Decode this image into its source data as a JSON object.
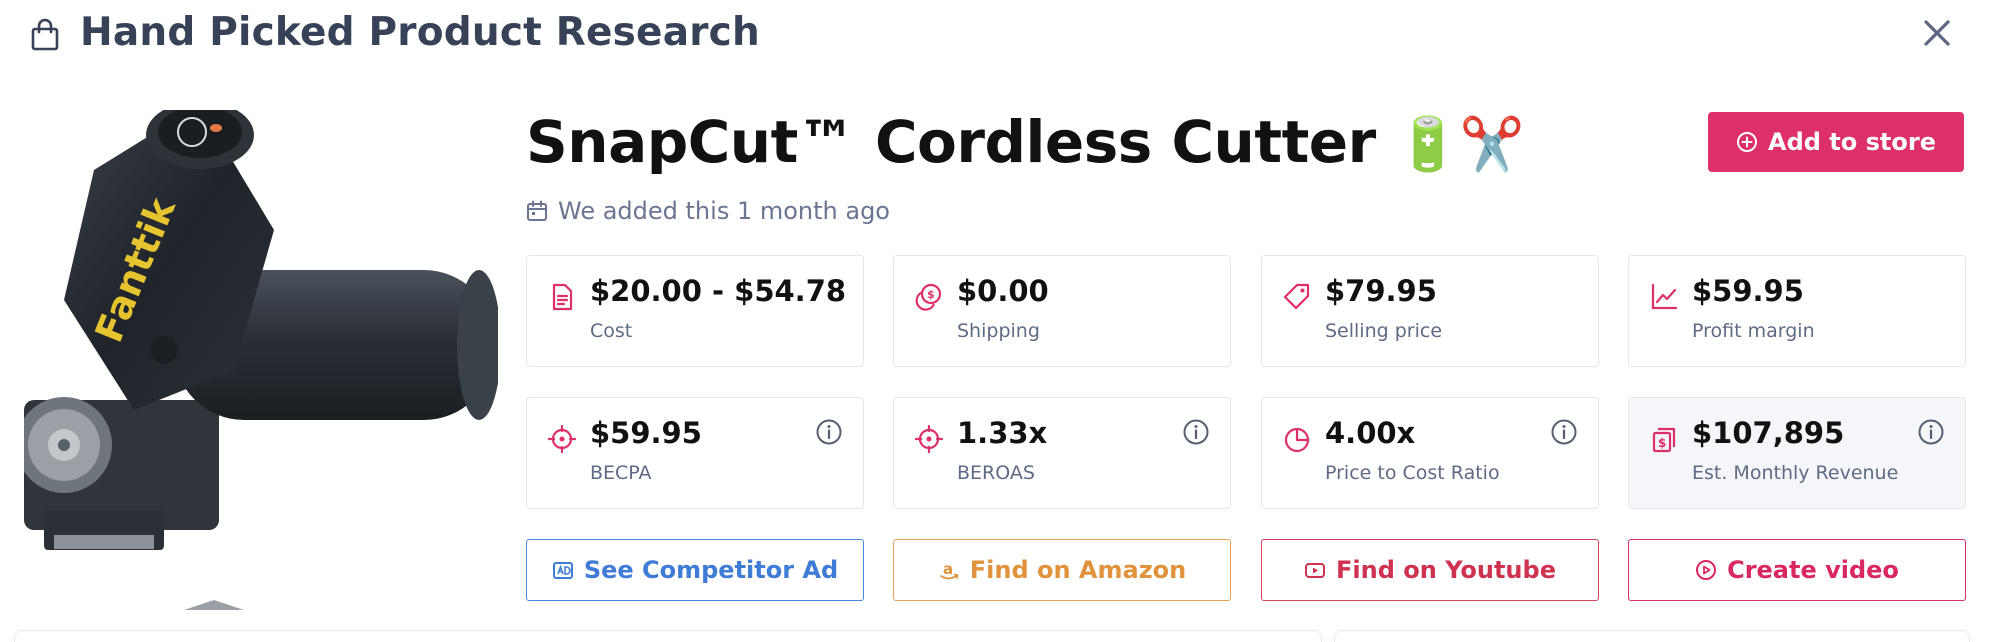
{
  "header": {
    "title": "Hand Picked Product Research",
    "icon": "shopping-bag-icon",
    "close_icon": "close-icon"
  },
  "product": {
    "title": "SnapCut™ Cordless Cutter",
    "title_emojis": "🔋✂️",
    "image_brand_text": "Fanttik",
    "added_text": "We added this 1 month ago",
    "added_icon": "calendar-icon"
  },
  "add_to_store": {
    "label": "Add to store",
    "icon": "plus-circle-icon",
    "color": "#dd2f6a"
  },
  "stats": [
    {
      "value": "$20.00 - $54.78",
      "label": "Cost",
      "icon": "document-icon"
    },
    {
      "value": "$0.00",
      "label": "Shipping",
      "icon": "coins-icon"
    },
    {
      "value": "$79.95",
      "label": "Selling price",
      "icon": "tag-icon"
    },
    {
      "value": "$59.95",
      "label": "Profit margin",
      "icon": "trend-chart-icon"
    },
    {
      "value": "$59.95",
      "label": "BECPA",
      "icon": "crosshair-icon"
    },
    {
      "value": "1.33x",
      "label": "BEROAS",
      "icon": "crosshair-icon"
    },
    {
      "value": "4.00x",
      "label": "Price to Cost Ratio",
      "icon": "pie-chart-icon"
    },
    {
      "value": "$107,895",
      "label": "Est. Monthly Revenue",
      "icon": "money-stack-icon"
    }
  ],
  "actions": [
    {
      "label": "See Competitor Ad",
      "icon": "ad-icon",
      "color": "#3f7cd6"
    },
    {
      "label": "Find on Amazon",
      "icon": "amazon-icon",
      "color": "#e0933c"
    },
    {
      "label": "Find on Youtube",
      "icon": "youtube-icon",
      "color": "#cf3150"
    },
    {
      "label": "Create video",
      "icon": "play-circle-icon",
      "color": "#d8285f"
    }
  ],
  "colors": {
    "accent": "#dd2f6a",
    "icon_pink": "#dd2f6a",
    "muted_text": "#5f6b84"
  }
}
